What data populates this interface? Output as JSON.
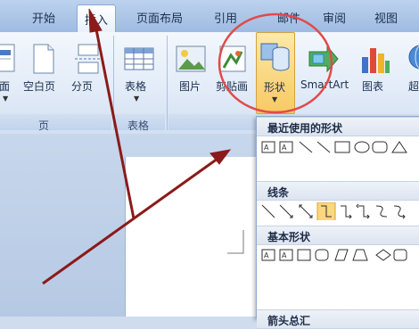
{
  "tabs": [
    {
      "label": "开始",
      "active": false
    },
    {
      "label": "插入",
      "active": true
    },
    {
      "label": "页面布局",
      "active": false
    },
    {
      "label": "引用",
      "active": false
    },
    {
      "label": "邮件",
      "active": false
    },
    {
      "label": "审阅",
      "active": false
    },
    {
      "label": "视图",
      "active": false
    }
  ],
  "ribbon": {
    "pages_group": {
      "label": "页",
      "buttons": [
        {
          "label": "面",
          "icon": "cover-page-icon"
        },
        {
          "label": "空白页",
          "icon": "blank-page-icon"
        },
        {
          "label": "分页",
          "icon": "page-break-icon"
        }
      ]
    },
    "table_group": {
      "label": "表格",
      "buttons": [
        {
          "label": "表格",
          "icon": "table-icon"
        }
      ]
    },
    "illustrations_group": {
      "buttons": [
        {
          "label": "图片",
          "icon": "picture-icon"
        },
        {
          "label": "剪贴画",
          "icon": "clipart-icon"
        },
        {
          "label": "形状",
          "icon": "shapes-icon",
          "highlighted": true
        },
        {
          "label": "SmartArt",
          "icon": "smartart-icon"
        },
        {
          "label": "图表",
          "icon": "chart-icon"
        },
        {
          "label": "超",
          "icon": "hyperlink-icon"
        }
      ]
    }
  },
  "shapes_menu": {
    "sections": [
      {
        "title": "最近使用的形状"
      },
      {
        "title": "线条"
      },
      {
        "title": "基本形状"
      },
      {
        "title": "箭头总汇"
      }
    ]
  },
  "annotations": {
    "circle_color": "#e24a4a",
    "arrow_color": "#8b1a1a"
  }
}
